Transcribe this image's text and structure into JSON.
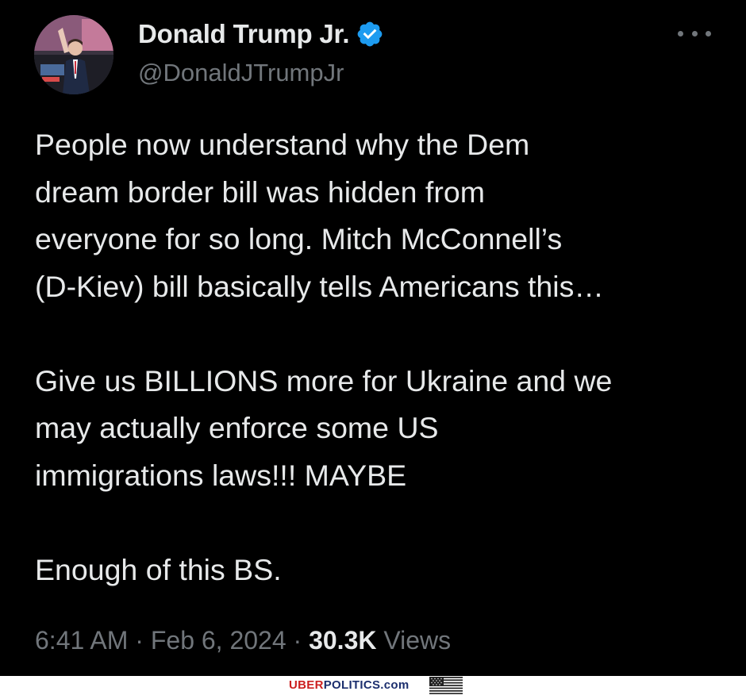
{
  "tweet": {
    "author": {
      "display_name": "Donald Trump Jr.",
      "handle": "@DonaldJTrumpJr",
      "verified": true,
      "verified_color": "#1d9bf0"
    },
    "more_icon": "more-horizontal-icon",
    "lines": [
      "People now understand why the Dem",
      "dream border bill was hidden from",
      "everyone for so long. Mitch McConnell’s",
      "(D-Kiev) bill basically tells Americans this…",
      "",
      "Give us BILLIONS more for Ukraine and we",
      "may actually enforce some US",
      "immigrations laws!!! MAYBE",
      "",
      "Enough of this BS."
    ],
    "meta": {
      "time": "6:41 AM",
      "separator": "·",
      "date": "Feb 6, 2024",
      "views_count": "30.3K",
      "views_label": "Views"
    }
  },
  "footer": {
    "brand_red": "UBER",
    "brand_blue": "POLITICS.com",
    "red_color": "#cc1f1f",
    "blue_color": "#1c2f6e",
    "flag_icon": "us-flag-icon"
  },
  "colors": {
    "background": "#000000",
    "text_primary": "#e7e9ea",
    "text_secondary": "#71767b"
  }
}
